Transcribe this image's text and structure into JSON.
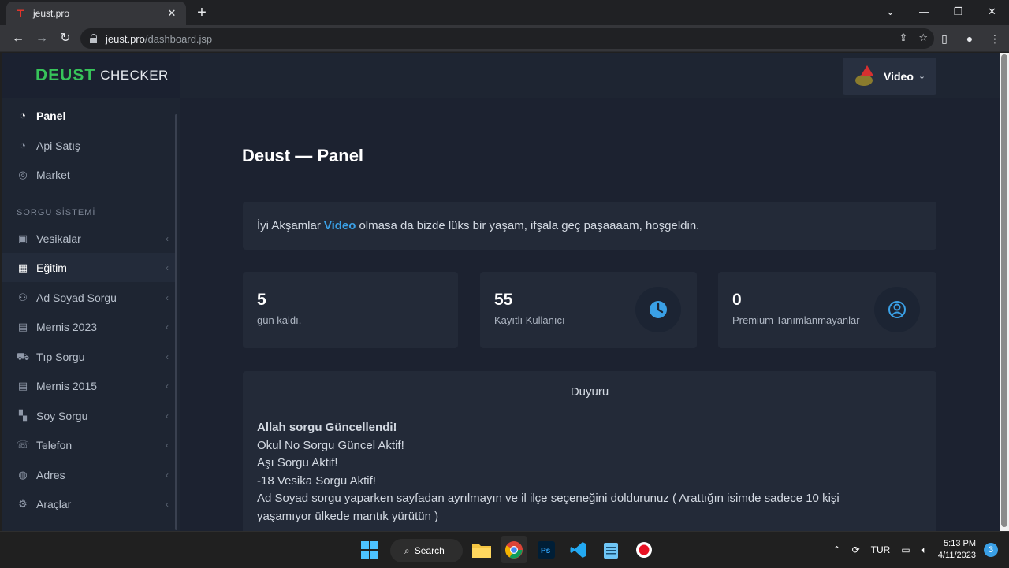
{
  "browser": {
    "tab_title": "jeust.pro",
    "tab_favicon": "T",
    "url_host": "jeust.pro",
    "url_path": "/dashboard.jsp"
  },
  "brand": {
    "part1": "DEUST",
    "part2": "CHECKER"
  },
  "user": {
    "name": "Video"
  },
  "sidebar": {
    "top_items": [
      {
        "label": "Panel",
        "icon": "gauge-icon"
      },
      {
        "label": "Api Satış",
        "icon": "gauge-icon"
      },
      {
        "label": "Market",
        "icon": "check-circle-icon"
      }
    ],
    "section": "SORGU SİSTEMİ",
    "items": [
      {
        "label": "Vesikalar",
        "icon": "camera-icon"
      },
      {
        "label": "Eğitim",
        "icon": "school-icon"
      },
      {
        "label": "Ad Soyad Sorgu",
        "icon": "users-icon"
      },
      {
        "label": "Mernis 2023",
        "icon": "id-card-icon"
      },
      {
        "label": "Tıp Sorgu",
        "icon": "ambulance-icon"
      },
      {
        "label": "Mernis 2015",
        "icon": "id-card-icon"
      },
      {
        "label": "Soy Sorgu",
        "icon": "tree-icon"
      },
      {
        "label": "Telefon",
        "icon": "phone-icon"
      },
      {
        "label": "Adres",
        "icon": "globe-icon"
      },
      {
        "label": "Araçlar",
        "icon": "gear-icon"
      }
    ]
  },
  "main": {
    "title": "Deust — Panel",
    "welcome": {
      "before": "İyi Akşamlar",
      "name": "Video",
      "after": "olmasa da bizde lüks bir yaşam, ifşala geç paşaaaam, hoşgeldin."
    },
    "stats": [
      {
        "value": "5",
        "label": "gün kaldı."
      },
      {
        "value": "55",
        "label": "Kayıtlı Kullanıcı",
        "icon": "clock-icon"
      },
      {
        "value": "0",
        "label": "Premium Tanımlanmayanlar",
        "icon": "user-circle-icon"
      }
    ],
    "announcement": {
      "title": "Duyuru",
      "lines": [
        "Allah sorgu Güncellendi!",
        "Okul No Sorgu Güncel Aktif!",
        "Aşı Sorgu Aktif!",
        "-18 Vesika Sorgu Aktif!",
        "Ad Soyad sorgu yaparken sayfadan ayrılmayın ve il ilçe seçeneğini doldurunuz ( Arattığın isimde sadece 10 kişi",
        "yaşamıyor ülkede mantık yürütün )"
      ]
    }
  },
  "taskbar": {
    "search_label": "Search",
    "language": "TUR",
    "time": "5:13 PM",
    "date": "4/11/2023",
    "notifications": "3"
  },
  "colors": {
    "accent": "#3aa0e6",
    "brand_green": "#37c45a",
    "page_bg": "#1c2230"
  }
}
